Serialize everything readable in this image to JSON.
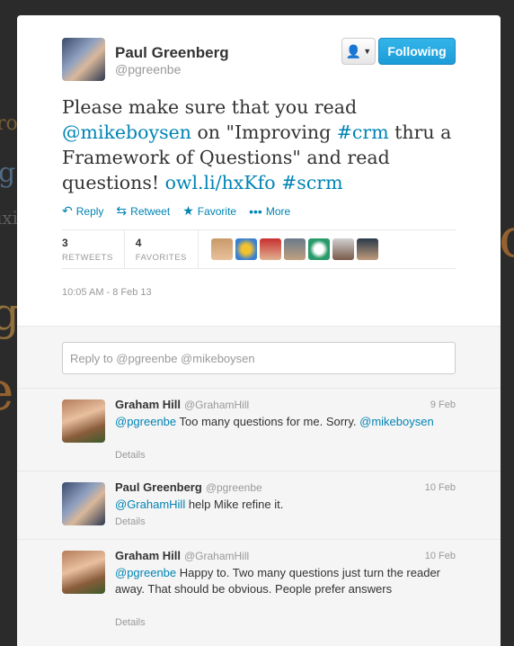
{
  "tweet": {
    "author_name": "Paul Greenberg",
    "author_handle": "@pgreenbe",
    "follow_label": "Following",
    "user_menu_icon": "user-dropdown-icon",
    "text_prefix": "Please make sure that you read ",
    "mention": "@mikeboysen",
    "text_mid": " on \"Improving ",
    "hashtag_crm": "#crm",
    "text_mid2": " thru a Framework of Questions\" and read questions! ",
    "link": "owl.li/hxKfo",
    "hashtag_scrm": "#scrm",
    "actions": {
      "reply": "Reply",
      "retweet": "Retweet",
      "favorite": "Favorite",
      "more": "More"
    },
    "stats": {
      "retweets_count": "3",
      "retweets_label": "RETWEETS",
      "favorites_count": "4",
      "favorites_label": "FAVORITES"
    },
    "timestamp": "10:05 AM - 8 Feb 13"
  },
  "reply_box": {
    "placeholder": "Reply to @pgreenbe @mikeboysen"
  },
  "replies": [
    {
      "name": "Graham Hill",
      "handle": "@GrahamHill",
      "date": "9 Feb",
      "mention": "@pgreenbe",
      "text": " Too many questions for me. Sorry. ",
      "mention2": "@mikeboysen",
      "details": "Details"
    },
    {
      "name": "Paul Greenberg",
      "handle": "@pgreenbe",
      "date": "10 Feb",
      "mention": "@GrahamHill",
      "text": " help Mike refine it.",
      "details": "Details"
    },
    {
      "name": "Graham Hill",
      "handle": "@GrahamHill",
      "date": "10 Feb",
      "mention": "@pgreenbe",
      "text": " Happy to. Two many questions just turn the reader away. That should be obvious. People prefer answers",
      "details": "Details"
    }
  ],
  "colors": {
    "link": "#0084b4",
    "follow": "#1c9cd8"
  }
}
